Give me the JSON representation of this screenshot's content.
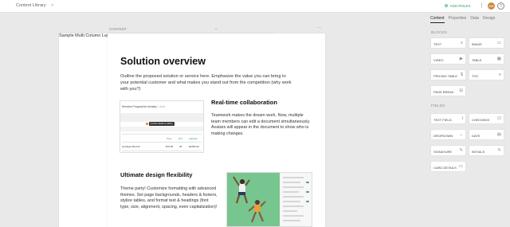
{
  "header": {
    "breadcrumb_root": "Content Library",
    "breadcrumb_sep": ">",
    "doc_title": "Sample Multi Column Layout",
    "add_roles": "ADD ROLES",
    "avatar_initials": "AW",
    "help": "?"
  },
  "panel_tabs": [
    "Content",
    "Properties",
    "Data",
    "Design"
  ],
  "canvas": {
    "section_label": "CONTENT",
    "chevron": "⌄",
    "more": "···"
  },
  "doc": {
    "title": "Solution overview",
    "intro": "Outline the proposed solution or service here. Emphasize the value you can bring to your potential customer and what makes you stand out from the competition (why work with you?)",
    "collab_heading": "Real-time collaboration",
    "collab_text": "Teamwork makes the dream work. Now, multiple team members can edit a document simultaneously. Avatars will appear in the document to show who is making changes.",
    "design_heading": "Ultimate design flexibility",
    "design_text": "Theme party! Customize formatting with advanced themes. Set page backgrounds, headers & footers, stylize tables, and format text & headings (font type, size, alignment, spacing, even capitalization)!",
    "mini": {
      "title": "Services Proposal for Acmeky",
      "title_muted": "1 draft",
      "pill": "Gordon Skaife is editing",
      "cols": [
        "Price",
        "QTY",
        "Subtotal"
      ],
      "row_name": "prindtyps BLACK",
      "row_price": "$75.00",
      "row_qty": "30",
      "row_sub": "$2250.00"
    }
  },
  "sidebar": {
    "blocks_label": "BLOCKS",
    "blocks": [
      {
        "label": "TEXT",
        "icon": "≡"
      },
      {
        "label": "IMAGE",
        "icon": "▭"
      },
      {
        "label": "VIDEO",
        "icon": "▶"
      },
      {
        "label": "TABLE",
        "icon": "▦"
      },
      {
        "label": "PRICING TABLE",
        "icon": "$"
      },
      {
        "label": "TOC",
        "icon": "≡"
      },
      {
        "label": "PAGE BREAK",
        "icon": "⊟"
      }
    ],
    "fields_label": "FIELDS",
    "fields": [
      {
        "label": "TEXT FIELD",
        "icon": "I"
      },
      {
        "label": "CHECKBOX",
        "icon": "☑"
      },
      {
        "label": "DROPDOWN",
        "icon": "⌄"
      },
      {
        "label": "DATE",
        "icon": "▤"
      },
      {
        "label": "SIGNATURE",
        "icon": "✎"
      },
      {
        "label": "INITIALS",
        "icon": "✎"
      },
      {
        "label": "CARD DETAILS",
        "icon": "▭"
      }
    ]
  },
  "colors": {
    "accent_green": "#2e9e57",
    "avatar": "#c98b3e",
    "photo_green": "#77c58f"
  }
}
